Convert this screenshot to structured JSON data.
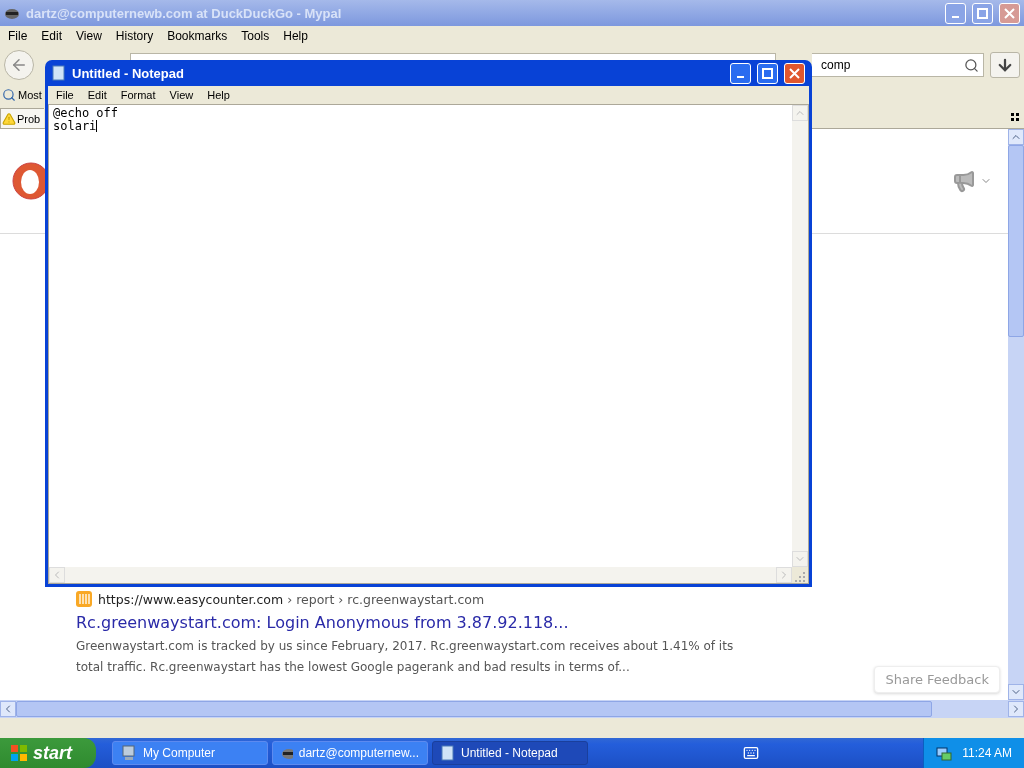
{
  "browser": {
    "title": "dartz@computernewb.com at DuckDuckGo - Mypal",
    "menu": [
      "File",
      "Edit",
      "View",
      "History",
      "Bookmarks",
      "Tools",
      "Help"
    ],
    "search": {
      "value": "comp"
    },
    "bookmarks": [
      {
        "label": "Most"
      }
    ],
    "tabs": [
      {
        "label": "Prob",
        "selected": true
      }
    ],
    "result": {
      "url": "https://www.easycounter.com",
      "breadcrumb": "› report › rc.greenwaystart.com",
      "title": "Rc.greenwaystart.com: Login Anonymous from 3.87.92.118...",
      "snippet": "Greenwaystart.com is tracked by us since February, 2017. Rc.greenwaystart.com receives about 1.41% of its total traffic. Rc.greenwaystart has the lowest Google pagerank and bad results in terms of..."
    },
    "feedback_button": "Share Feedback"
  },
  "notepad": {
    "title": "Untitled - Notepad",
    "menu": [
      "File",
      "Edit",
      "Format",
      "View",
      "Help"
    ],
    "text": "@echo off\nsolari"
  },
  "taskbar": {
    "start": "start",
    "items": [
      {
        "label": "My Computer",
        "kind": "computer",
        "selected": false
      },
      {
        "label": "dartz@computernew...",
        "kind": "browser",
        "selected": false
      },
      {
        "label": "Untitled - Notepad",
        "kind": "notepad",
        "selected": true
      }
    ],
    "clock": "11:24 AM"
  }
}
